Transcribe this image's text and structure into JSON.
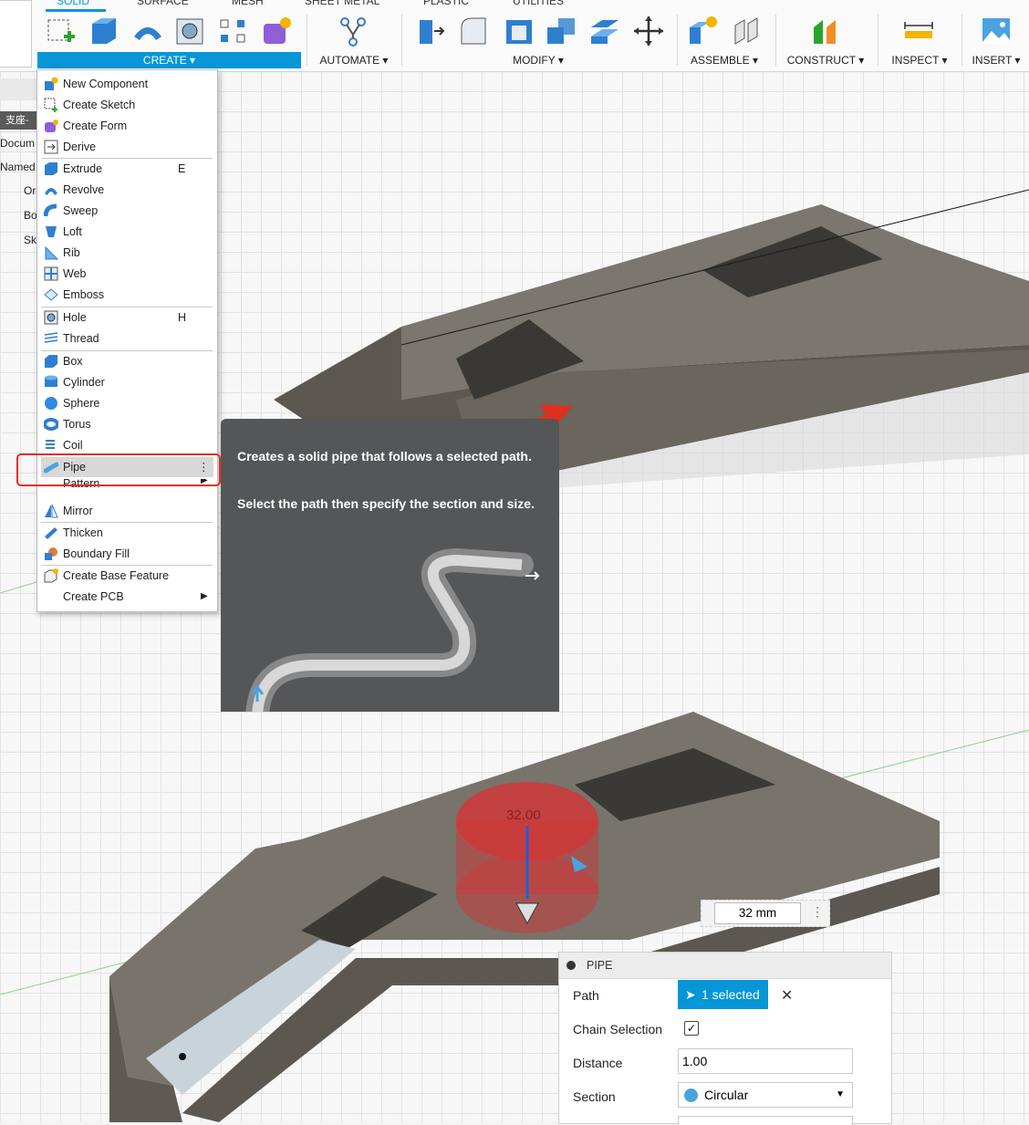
{
  "toolbar": {
    "tabs": [
      "SOLID",
      "SURFACE",
      "MESH",
      "SHEET METAL",
      "PLASTIC",
      "UTILITIES"
    ],
    "groups": {
      "create": "CREATE ▾",
      "automate": "AUTOMATE ▾",
      "modify": "MODIFY ▾",
      "assemble": "ASSEMBLE ▾",
      "construct": "CONSTRUCT ▾",
      "inspect": "INSPECT ▾",
      "insert": "INSERT ▾"
    }
  },
  "browser": {
    "header": "支座-",
    "rows": [
      "Docum",
      "Named",
      "Or",
      "Bo",
      "Sk"
    ]
  },
  "create_menu": {
    "items": [
      {
        "label": "New Component",
        "shortcut": ""
      },
      {
        "label": "Create Sketch",
        "shortcut": ""
      },
      {
        "label": "Create Form",
        "shortcut": ""
      },
      {
        "label": "Derive",
        "shortcut": ""
      },
      {
        "label": "Extrude",
        "shortcut": "E"
      },
      {
        "label": "Revolve",
        "shortcut": ""
      },
      {
        "label": "Sweep",
        "shortcut": ""
      },
      {
        "label": "Loft",
        "shortcut": ""
      },
      {
        "label": "Rib",
        "shortcut": ""
      },
      {
        "label": "Web",
        "shortcut": ""
      },
      {
        "label": "Emboss",
        "shortcut": ""
      },
      {
        "label": "Hole",
        "shortcut": "H"
      },
      {
        "label": "Thread",
        "shortcut": ""
      },
      {
        "label": "Box",
        "shortcut": ""
      },
      {
        "label": "Cylinder",
        "shortcut": ""
      },
      {
        "label": "Sphere",
        "shortcut": ""
      },
      {
        "label": "Torus",
        "shortcut": ""
      },
      {
        "label": "Coil",
        "shortcut": ""
      },
      {
        "label": "Pipe",
        "shortcut": "⋮"
      },
      {
        "label": "Pattern",
        "shortcut": ""
      },
      {
        "label": "Mirror",
        "shortcut": ""
      },
      {
        "label": "Thicken",
        "shortcut": ""
      },
      {
        "label": "Boundary Fill",
        "shortcut": ""
      },
      {
        "label": "Create Base Feature",
        "shortcut": ""
      },
      {
        "label": "Create PCB",
        "shortcut": ""
      }
    ]
  },
  "tooltip": {
    "line1": "Creates a solid pipe that follows a selected path.",
    "line2": "Select the path then specify the section and size."
  },
  "viewport": {
    "dimension_label": "32.00",
    "dimension_input": "32 mm"
  },
  "pipe_panel": {
    "title": "PIPE",
    "path_label": "Path",
    "path_value": "1 selected",
    "chain_label": "Chain Selection",
    "chain_checked": "✓",
    "distance_label": "Distance",
    "distance_value": "1.00",
    "section_label": "Section",
    "section_value": "Circular"
  },
  "colors": {
    "accent": "#0696d7",
    "highlight_box": "#e0301e",
    "model": "#6f6a62",
    "pipe_preview": "#c83a3a"
  }
}
